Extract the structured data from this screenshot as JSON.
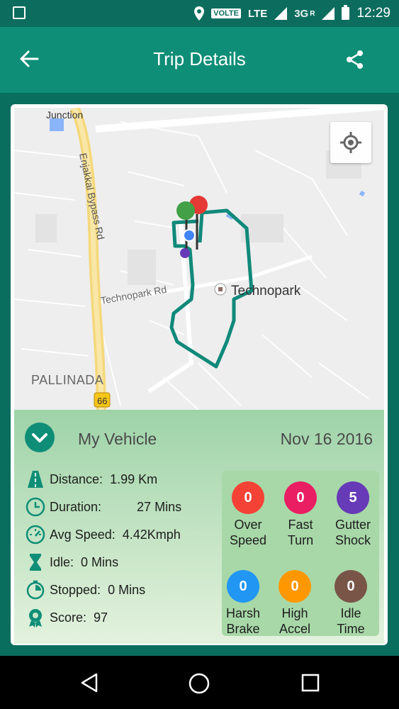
{
  "status_bar": {
    "volte": "VOLTE",
    "lte": "LTE",
    "network": "3G",
    "roaming": "R",
    "time": "12:29"
  },
  "toolbar": {
    "title": "Trip Details"
  },
  "map": {
    "labels": {
      "junction": "Junction",
      "bypass": "Enjakkal Bypass Rd",
      "technopark_rd": "Technopark Rd",
      "technopark": "Technopark",
      "pallinada": "PALLINADA",
      "route_number": "66"
    }
  },
  "trip": {
    "vehicle": "My Vehicle",
    "date": "Nov 16 2016",
    "stats": {
      "distance_label": "Distance:",
      "distance_value": "1.99 Km",
      "duration_label": "Duration:",
      "duration_value": "27 Mins",
      "avg_speed_label": "Avg Speed:",
      "avg_speed_value": "4.42Kmph",
      "idle_label": "Idle:",
      "idle_value": "0 Mins",
      "stopped_label": "Stopped:",
      "stopped_value": "0 Mins",
      "score_label": "Score:",
      "score_value": "97"
    },
    "events": [
      {
        "count": "0",
        "line1": "Over",
        "line2": "Speed",
        "color": "#f44336"
      },
      {
        "count": "0",
        "line1": "Fast",
        "line2": "Turn",
        "color": "#e91e63"
      },
      {
        "count": "5",
        "line1": "Gutter",
        "line2": "Shock",
        "color": "#673ab7"
      },
      {
        "count": "0",
        "line1": "Harsh",
        "line2": "Brake",
        "color": "#2196f3"
      },
      {
        "count": "0",
        "line1": "High",
        "line2": "Accel",
        "color": "#ff9800"
      },
      {
        "count": "0",
        "line1": "Idle",
        "line2": "Time",
        "color": "#795548"
      }
    ]
  },
  "colors": {
    "primary": "#0f8e77",
    "primary_dark": "#0c6d5e",
    "route": "#10897a"
  },
  "icons": [
    "image-icon",
    "location-icon",
    "signal-icon",
    "battery-icon",
    "back-arrow-icon",
    "share-icon",
    "my-location-icon",
    "chevron-down-icon",
    "road-icon",
    "clock-icon",
    "speedometer-icon",
    "hourglass-icon",
    "stopwatch-icon",
    "award-icon",
    "back-nav-icon",
    "home-nav-icon",
    "recents-nav-icon"
  ]
}
